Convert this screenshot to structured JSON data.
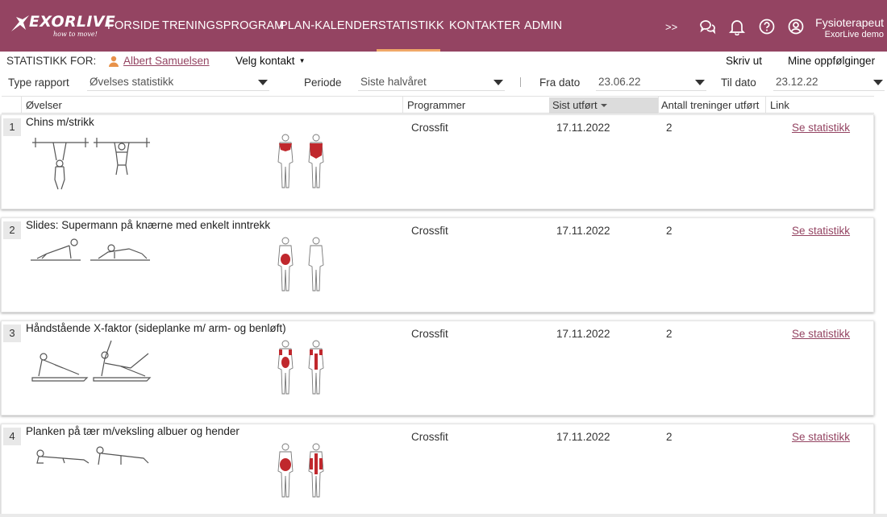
{
  "header": {
    "logo_text": "EXORLIVE",
    "logo_tagline": "how to move!",
    "nav": [
      {
        "label": "FORSIDE",
        "active": false
      },
      {
        "label": "TRENINGSPROGRAM",
        "active": false
      },
      {
        "label": "PLAN-KALENDER",
        "active": false
      },
      {
        "label": "STATISTIKK",
        "active": true
      },
      {
        "label": "KONTAKTER",
        "active": false
      },
      {
        "label": "ADMIN",
        "active": false
      }
    ],
    "expand_label": ">>",
    "icons": [
      "chat-icon",
      "bell-icon",
      "help-icon",
      "user-circle-icon"
    ],
    "user": {
      "role": "Fysioterapeut",
      "org": "ExorLive demo"
    },
    "colors": {
      "brand": "#944462",
      "active_underline": "#f0a868"
    }
  },
  "context_bar": {
    "stat_for_label": "STATISTIKK FOR:",
    "contact_name": "Albert Samuelsen",
    "choose_contact": "Velg kontakt",
    "print": "Skriv ut",
    "followups": "Mine oppfølginger"
  },
  "filters": {
    "report_type_label": "Type rapport",
    "report_type_value": "Øvelses statistikk",
    "period_label": "Periode",
    "period_value": "Siste halvåret",
    "from_label": "Fra dato",
    "from_value": "23.06.22",
    "to_label": "Til dato",
    "to_value": "23.12.22"
  },
  "table": {
    "columns": {
      "exercises": "Øvelser",
      "programs": "Programmer",
      "last_done": "Sist utført",
      "count": "Antall treninger utført",
      "link": "Link"
    },
    "sorted_column": "last_done",
    "rows": [
      {
        "num": "1",
        "name": "Chins m/strikk",
        "program": "Crossfit",
        "last_done": "17.11.2022",
        "count": "2",
        "link": "Se statistikk",
        "muscles": "upper-back"
      },
      {
        "num": "2",
        "name": "Slides: Supermann på knærne med enkelt inntrekk",
        "program": "Crossfit",
        "last_done": "17.11.2022",
        "count": "2",
        "link": "Se statistikk",
        "muscles": "abs"
      },
      {
        "num": "3",
        "name": "Håndstående X-faktor (sideplanke m/ arm- og benløft)",
        "program": "Crossfit",
        "last_done": "17.11.2022",
        "count": "2",
        "link": "Se statistikk",
        "muscles": "core-shoulders"
      },
      {
        "num": "4",
        "name": "Planken på tær m/veksling albuer og hender",
        "program": "Crossfit",
        "last_done": "17.11.2022",
        "count": "2",
        "link": "Se statistikk",
        "muscles": "abs-back"
      }
    ]
  }
}
